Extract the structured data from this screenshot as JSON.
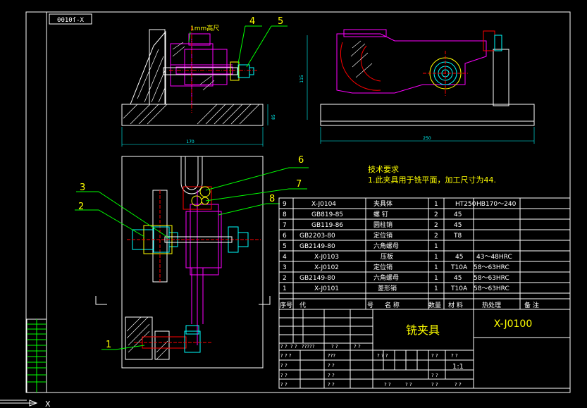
{
  "stamp": "0010ſ-X",
  "callouts": {
    "surface_note": "1mm高尺",
    "n1": "1",
    "n2": "2",
    "n3": "3",
    "n4": "4",
    "n5": "5",
    "n6": "6",
    "n7": "7",
    "n8": "8"
  },
  "dims": {
    "front_height": "85",
    "front_width": "170",
    "side_height": "115",
    "side_width": "250"
  },
  "tech": {
    "heading": "技术要求",
    "line1": "1.此夹具用于铣平面，加工尺寸为44."
  },
  "bom": {
    "rows": [
      {
        "no": "9",
        "code": "X-J0104",
        "name": "夹具体",
        "qty": "1",
        "mat": "HT250",
        "heat": "HB170～240"
      },
      {
        "no": "8",
        "code": "GB819-85",
        "name": "螺 钉",
        "qty": "2",
        "mat": "45",
        "heat": ""
      },
      {
        "no": "7",
        "code": "GB119-86",
        "name": "圆柱销",
        "qty": "2",
        "mat": "45",
        "heat": ""
      },
      {
        "no": "6",
        "code": "GB2203-80",
        "name": "定位销",
        "qty": "2",
        "mat": "T8",
        "heat": ""
      },
      {
        "no": "5",
        "code": "GB2149-80",
        "name": "六角螺母",
        "qty": "1",
        "mat": "",
        "heat": ""
      },
      {
        "no": "4",
        "code": "X-J0103",
        "name": "压板",
        "qty": "1",
        "mat": "45",
        "heat": "43～48HRC"
      },
      {
        "no": "3",
        "code": "X-J0102",
        "name": "定位销",
        "qty": "1",
        "mat": "T10A",
        "heat": "58～63HRC"
      },
      {
        "no": "2",
        "code": "GB2149-80",
        "name": "六角螺母",
        "qty": "1",
        "mat": "45",
        "heat": "58～63HRC"
      },
      {
        "no": "1",
        "code": "X-J0101",
        "name": "菱形销",
        "qty": "1",
        "mat": "T10A",
        "heat": "58～63HRC"
      }
    ],
    "header": {
      "no": "序号",
      "code": "代",
      "code2": "号",
      "name": "名 称",
      "qty": "数量",
      "mat": "材 料",
      "heat": "热处理",
      "remark": "备 注"
    }
  },
  "title_block": {
    "name": "铣夹具",
    "drawing_no": "X-J0100",
    "scale": "1:1",
    "q2": "? ?",
    "q3": "? ? ?",
    "q4": "?????",
    "q5": "???"
  },
  "ucs": {
    "x_label": "X"
  }
}
